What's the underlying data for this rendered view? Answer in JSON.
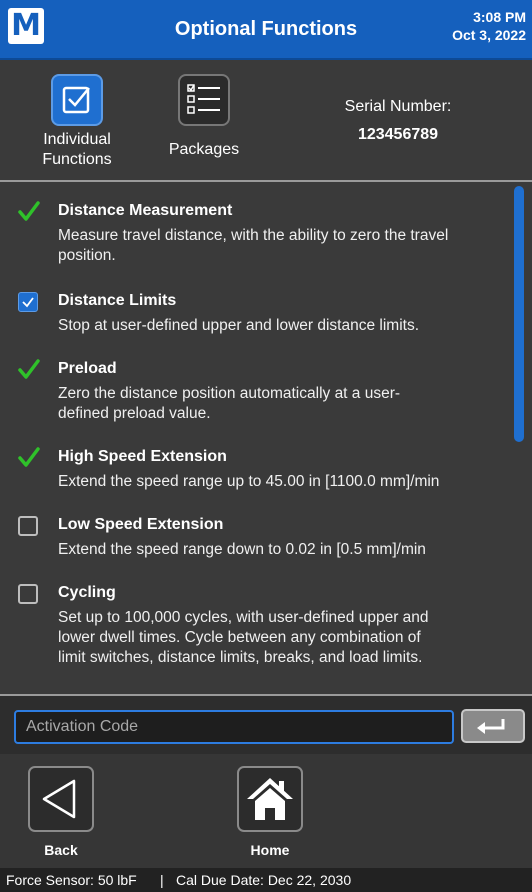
{
  "header": {
    "logo_text": "M",
    "title": "Optional Functions",
    "time": "3:08 PM",
    "date": "Oct 3, 2022",
    "brand_color": "#1560bd"
  },
  "modes": {
    "individual_label_line1": "Individual",
    "individual_label_line2": "Functions",
    "packages_label": "Packages",
    "active": "Individual Functions"
  },
  "serial": {
    "label": "Serial Number:",
    "value": "123456789"
  },
  "functions": [
    {
      "title": "Distance Measurement",
      "desc": [
        "Measure travel distance, with the ability to zero the travel",
        "position."
      ],
      "state": "enabled-check"
    },
    {
      "title": "Distance Limits",
      "desc": [
        "Stop at user-defined upper and lower distance limits."
      ],
      "state": "checkbox-checked"
    },
    {
      "title": "Preload",
      "desc": [
        "Zero the distance position automatically at a user-",
        "defined preload value."
      ],
      "state": "enabled-check"
    },
    {
      "title": "High Speed Extension",
      "desc": [
        "Extend the speed range up to 45.00 in [1100.0 mm]/min"
      ],
      "state": "enabled-check"
    },
    {
      "title": "Low Speed Extension",
      "desc": [
        "Extend the speed range down to 0.02 in [0.5 mm]/min"
      ],
      "state": "checkbox-empty"
    },
    {
      "title": "Cycling",
      "desc": [
        "Set up to 100,000 cycles, with user-defined upper and",
        "lower dwell times. Cycle between any combination of",
        "limit switches, distance limits, breaks, and load limits."
      ],
      "state": "checkbox-empty"
    }
  ],
  "activation": {
    "placeholder": "Activation Code",
    "value": ""
  },
  "nav": {
    "back_label": "Back",
    "home_label": "Home"
  },
  "status": {
    "force_sensor": "Force Sensor: 50 lbF",
    "separator": "|",
    "cal_due": "Cal Due Date: Dec 22, 2030"
  },
  "colors": {
    "check_green": "#2fc12a",
    "accent_blue": "#1f6fd0"
  }
}
